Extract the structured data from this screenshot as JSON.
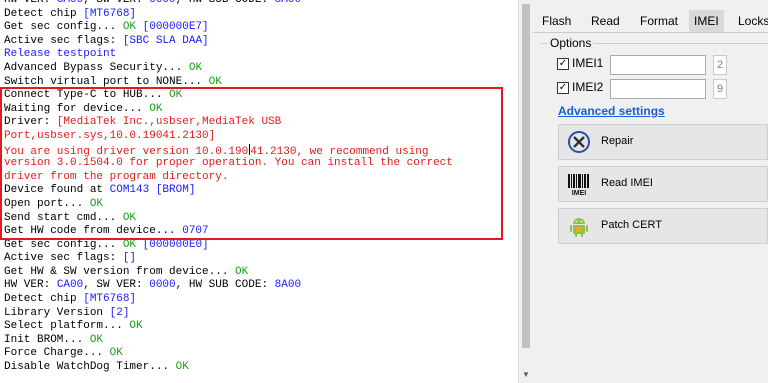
{
  "log": {
    "lines": [
      [
        {
          "t": "HW VER: ",
          "c": "k"
        },
        {
          "t": "CA00",
          "c": "b"
        },
        {
          "t": ", SW VER: ",
          "c": "k"
        },
        {
          "t": "0000",
          "c": "b"
        },
        {
          "t": ", HW SUB CODE: ",
          "c": "k"
        },
        {
          "t": "8A00",
          "c": "b"
        }
      ],
      [
        {
          "t": "Detect chip ",
          "c": "k"
        },
        {
          "t": "[MT6768]",
          "c": "b"
        }
      ],
      [
        {
          "t": "Get sec config... ",
          "c": "k"
        },
        {
          "t": "OK",
          "c": "ok"
        },
        {
          "t": " [000000E7]",
          "c": "b"
        }
      ],
      [
        {
          "t": "Active sec flags: ",
          "c": "k"
        },
        {
          "t": "[SBC SLA DAA]",
          "c": "b"
        }
      ],
      [
        {
          "t": "Release testpoint",
          "c": "b"
        }
      ],
      [
        {
          "t": "Advanced Bypass Security... ",
          "c": "k"
        },
        {
          "t": "OK",
          "c": "ok"
        }
      ],
      [
        {
          "t": "Switch virtual port to NONE... ",
          "c": "k"
        },
        {
          "t": "OK",
          "c": "ok"
        }
      ],
      [
        {
          "t": "Connect Type-C to HUB... ",
          "c": "k"
        },
        {
          "t": "OK",
          "c": "ok"
        }
      ],
      [
        {
          "t": "Waiting for device... ",
          "c": "k"
        },
        {
          "t": "OK",
          "c": "ok"
        }
      ],
      [
        {
          "t": "Driver: ",
          "c": "k"
        },
        {
          "t": "[MediaTek Inc.,usbser,MediaTek USB",
          "c": "r"
        }
      ],
      [
        {
          "t": "Port,usbser.sys,10.0.19041.2130]",
          "c": "r"
        }
      ],
      [
        {
          "t": "You are using driver version 10.0.190",
          "c": "r"
        },
        {
          "t": "",
          "c": "cursor"
        },
        {
          "t": "41.2130, we recommend using",
          "c": "r"
        }
      ],
      [
        {
          "t": "version 3.0.1504.0 for proper operation. You can install the correct",
          "c": "r"
        }
      ],
      [
        {
          "t": "driver from the program directory.",
          "c": "r"
        }
      ],
      [
        {
          "t": "Device found at ",
          "c": "k"
        },
        {
          "t": "COM143",
          "c": "b"
        },
        {
          "t": " [BROM]",
          "c": "b"
        }
      ],
      [
        {
          "t": "Open port... ",
          "c": "k"
        },
        {
          "t": "OK",
          "c": "ok"
        }
      ],
      [
        {
          "t": "Send start cmd... ",
          "c": "k"
        },
        {
          "t": "OK",
          "c": "ok"
        }
      ],
      [
        {
          "t": "Get HW code from device... ",
          "c": "k"
        },
        {
          "t": "0707",
          "c": "b"
        }
      ],
      [
        {
          "t": "Get sec config... ",
          "c": "k"
        },
        {
          "t": "OK",
          "c": "ok"
        },
        {
          "t": " [000000E0]",
          "c": "b"
        }
      ],
      [
        {
          "t": "Active sec flags: ",
          "c": "k"
        },
        {
          "t": "[]",
          "c": "b"
        }
      ],
      [
        {
          "t": "Get HW & SW version from device... ",
          "c": "k"
        },
        {
          "t": "OK",
          "c": "ok"
        }
      ],
      [
        {
          "t": "HW VER: ",
          "c": "k"
        },
        {
          "t": "CA00",
          "c": "b"
        },
        {
          "t": ", SW VER: ",
          "c": "k"
        },
        {
          "t": "0000",
          "c": "b"
        },
        {
          "t": ", HW SUB CODE: ",
          "c": "k"
        },
        {
          "t": "8A00",
          "c": "b"
        }
      ],
      [
        {
          "t": "Detect chip ",
          "c": "k"
        },
        {
          "t": "[MT6768]",
          "c": "b"
        }
      ],
      [
        {
          "t": "Library Version ",
          "c": "k"
        },
        {
          "t": "[2]",
          "c": "b"
        }
      ],
      [
        {
          "t": "Select platform... ",
          "c": "k"
        },
        {
          "t": "OK",
          "c": "ok"
        }
      ],
      [
        {
          "t": "Init BROM... ",
          "c": "k"
        },
        {
          "t": "OK",
          "c": "ok"
        }
      ],
      [
        {
          "t": "Force Charge... ",
          "c": "k"
        },
        {
          "t": "OK",
          "c": "ok"
        }
      ],
      [
        {
          "t": "Disable WatchDog Timer... ",
          "c": "k"
        },
        {
          "t": "OK",
          "c": "ok"
        }
      ]
    ]
  },
  "tabs": [
    {
      "label": "Flash",
      "active": false
    },
    {
      "label": "Read",
      "active": false
    },
    {
      "label": "Format",
      "active": false
    },
    {
      "label": "IMEI",
      "active": true
    },
    {
      "label": "Locks",
      "active": false
    }
  ],
  "options": {
    "title": "Options",
    "imei1": {
      "label": "IMEI1",
      "checked": true,
      "value": "",
      "count": "2"
    },
    "imei2": {
      "label": "IMEI2",
      "checked": true,
      "value": "",
      "count": "9"
    },
    "advanced_link": "Advanced settings"
  },
  "buttons": [
    {
      "label": "Repair",
      "icon": "repair-icon"
    },
    {
      "label": "Read IMEI",
      "icon": "barcode-icon"
    },
    {
      "label": "Patch CERT",
      "icon": "android-icon"
    }
  ],
  "colors": {
    "ok": "#19a019",
    "info": "#1a1aff",
    "warning": "#e21b1b",
    "highlight": "#e01b24",
    "link": "#1e5bd6"
  }
}
